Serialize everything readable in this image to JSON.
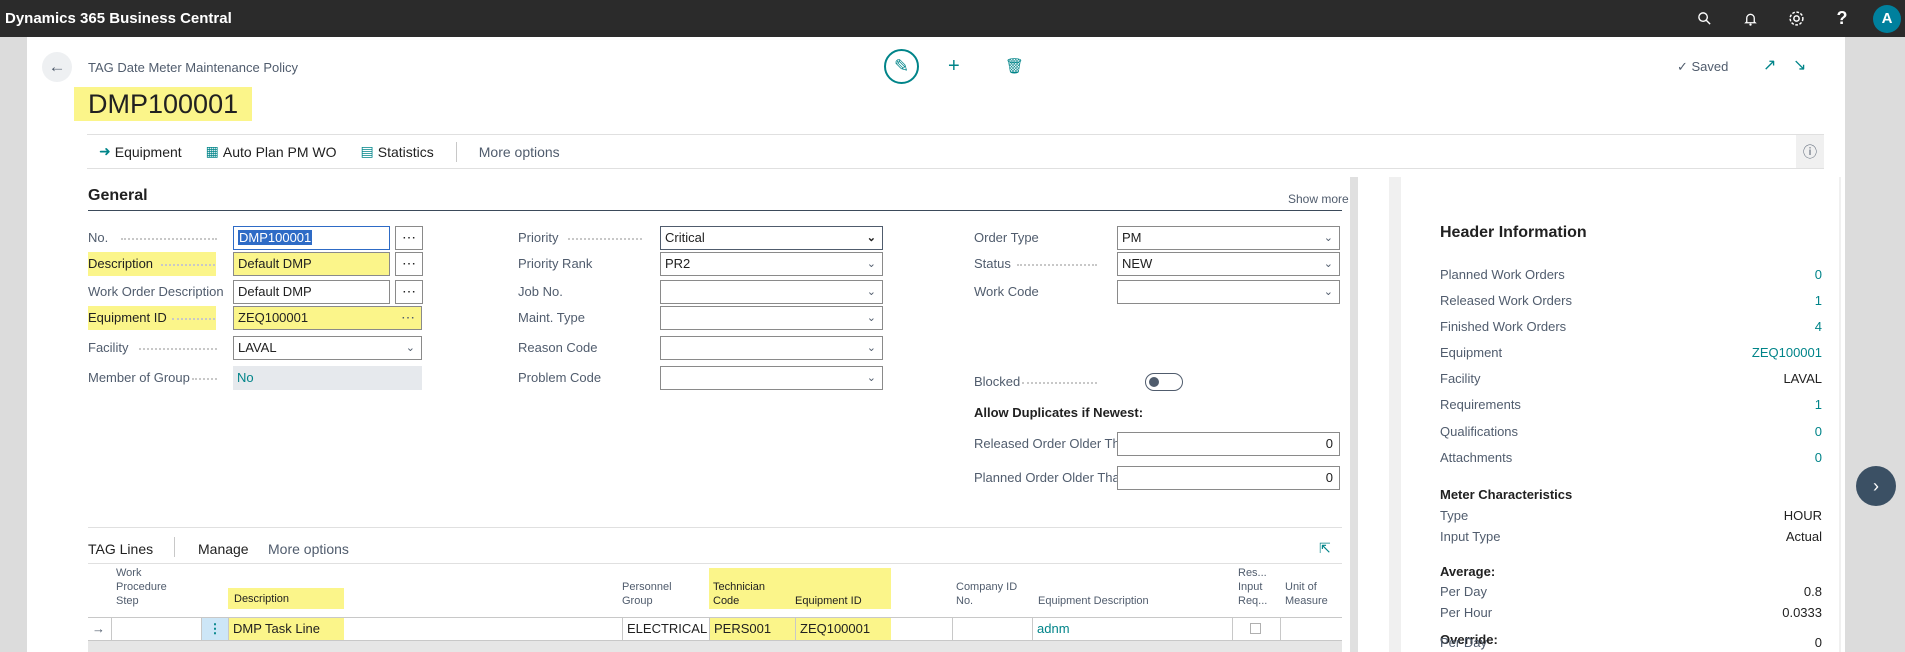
{
  "topbar": {
    "brand": "Dynamics 365 Business Central",
    "icons": [
      "search-icon",
      "bell-icon",
      "gear-icon",
      "help-icon"
    ],
    "avatar": "A"
  },
  "header": {
    "caption": "TAG Date Meter Maintenance Policy",
    "title": "DMP100001",
    "saved": "Saved"
  },
  "actions": {
    "equipment": "Equipment",
    "autoplan": "Auto Plan PM WO",
    "statistics": "Statistics",
    "more": "More options"
  },
  "general": {
    "title": "General",
    "showmore": "Show more",
    "col1": [
      {
        "label": "No.",
        "value": "DMP100001"
      },
      {
        "label": "Description",
        "value": "Default DMP"
      },
      {
        "label": "Work Order Description",
        "value": "Default DMP"
      },
      {
        "label": "Equipment ID",
        "value": "ZEQ100001"
      },
      {
        "label": "Facility",
        "value": "LAVAL"
      },
      {
        "label": "Member of Group",
        "value": "No"
      }
    ],
    "col2": [
      {
        "label": "Priority",
        "value": "Critical"
      },
      {
        "label": "Priority Rank",
        "value": "PR2"
      },
      {
        "label": "Job No.",
        "value": ""
      },
      {
        "label": "Maint. Type",
        "value": ""
      },
      {
        "label": "Reason Code",
        "value": ""
      },
      {
        "label": "Problem Code",
        "value": ""
      }
    ],
    "col3": [
      {
        "label": "Order Type",
        "value": "PM"
      },
      {
        "label": "Status",
        "value": "NEW"
      },
      {
        "label": "Work Code",
        "value": ""
      },
      {
        "label": "Blocked",
        "value": ""
      }
    ],
    "allow_dup": "Allow Duplicates if Newest:",
    "released_older": {
      "label": "Released Order Older Th...",
      "value": "0"
    },
    "planned_older": {
      "label": "Planned Order Older Tha...",
      "value": "0"
    }
  },
  "factbox": {
    "title": "Header Information",
    "rows": [
      {
        "label": "Planned Work Orders",
        "value": "0"
      },
      {
        "label": "Released Work Orders",
        "value": "1"
      },
      {
        "label": "Finished Work Orders",
        "value": "4"
      },
      {
        "label": "Equipment",
        "value": "ZEQ100001"
      },
      {
        "label": "Facility",
        "value": "LAVAL"
      },
      {
        "label": "Requirements",
        "value": "1"
      },
      {
        "label": "Qualifications",
        "value": "0"
      },
      {
        "label": "Attachments",
        "value": "0"
      }
    ],
    "meter_title": "Meter Characteristics",
    "meter": [
      {
        "label": "Type",
        "value": "HOUR"
      },
      {
        "label": "Input Type",
        "value": "Actual"
      }
    ],
    "average_title": "Average:",
    "average": [
      {
        "label": "Per Day",
        "value": "0.8"
      },
      {
        "label": "Per Hour",
        "value": "0.0333"
      }
    ],
    "override_title": "Override:",
    "override": [
      {
        "label": "Per Day",
        "value": "0"
      }
    ]
  },
  "lines": {
    "title": "TAG Lines",
    "manage": "Manage",
    "more": "More options",
    "headers": {
      "wps": [
        "Work",
        "Procedure",
        "Step"
      ],
      "desc": "Description",
      "pg": [
        "Personnel",
        "Group"
      ],
      "tc": [
        "Technician",
        "Code"
      ],
      "eq": "Equipment ID",
      "cid": [
        "Company ID",
        "No."
      ],
      "eqd": "Equipment Description",
      "riq": [
        "Res...",
        "Input",
        "Req..."
      ],
      "uom": [
        "Unit of",
        "Measure"
      ]
    },
    "row1": {
      "desc": "DMP Task Line",
      "pg": "ELECTRICAL",
      "tc": "PERS001",
      "eq": "ZEQ100001",
      "eqd": "adnm"
    }
  }
}
